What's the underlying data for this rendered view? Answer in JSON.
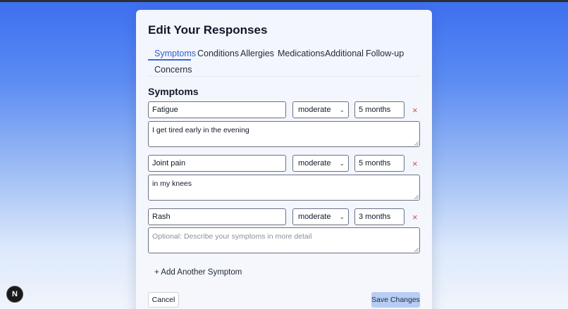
{
  "form": {
    "title": "Edit Your Responses",
    "tabs": [
      {
        "label": "Symptoms",
        "active": true
      },
      {
        "label": "Conditions",
        "active": false
      },
      {
        "label": "Allergies",
        "active": false
      },
      {
        "label": "Medications",
        "active": false
      },
      {
        "label": "Additional",
        "active": false
      },
      {
        "label": "Follow-up",
        "active": false
      },
      {
        "label": "Concerns",
        "active": false
      }
    ],
    "section_title": "Symptoms",
    "symptoms": [
      {
        "name": "Fatigue",
        "severity": "moderate",
        "duration": "5 months",
        "details": "I get tired early in the evening",
        "remove": "×"
      },
      {
        "name": "Joint pain",
        "severity": "moderate",
        "duration": "5 months",
        "details": "in my knees",
        "remove": "×"
      },
      {
        "name": "Rash",
        "severity": "moderate",
        "duration": "3 months",
        "details": "",
        "details_placeholder": "Optional: Describe your symptoms in more detail",
        "remove": "×"
      }
    ],
    "add_symptom_label": "+ Add Another Symptom",
    "cancel_label": "Cancel",
    "save_label": "Save Changes"
  },
  "badge": {
    "label": "N"
  },
  "colors": {
    "accent": "#3b67d8",
    "remove": "#e04848",
    "save_button_bg": "#b8cdf3",
    "background_top": "#3d6ff0"
  }
}
